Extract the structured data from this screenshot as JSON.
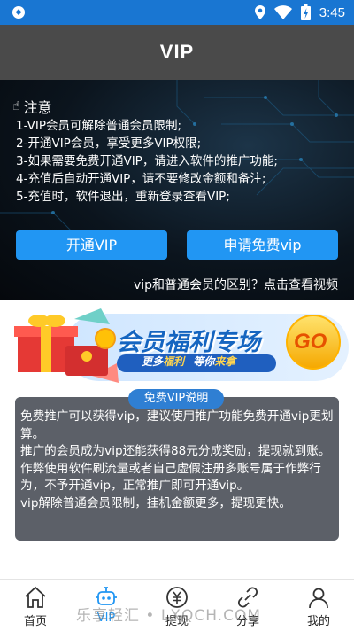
{
  "status_bar": {
    "time": "3:45"
  },
  "header": {
    "title": "VIP"
  },
  "notice": {
    "title": "注意",
    "items": [
      "1-VIP会员可解除普通会员限制;",
      "2-开通VIP会员，享受更多VIP权限;",
      "3-如果需要免费开通VIP，请进入软件的推广功能;",
      "4-充值后自动开通VIP，请不要修改金额和备注;",
      "5-充值时，软件退出，重新登录查看VIP;"
    ]
  },
  "buttons": {
    "open_vip": "开通VIP",
    "apply_free_vip": "申请免费vip"
  },
  "video_link": "vip和普通会员的区别？点击查看视频",
  "banner": {
    "title": "会员福利专场",
    "slogan_prefix": "更多",
    "slogan_welfare": "福利",
    "slogan_mid": "等你",
    "slogan_end": "来拿",
    "go": "GO"
  },
  "free_vip_info": {
    "label": "免费VIP说明",
    "paragraphs": [
      "免费推广可以获得vip，建议使用推广功能免费开通vip更划算。",
      "推广的会员成为vip还能获得88元分成奖励，提现就到账。",
      "作弊使用软件刷流量或者自己虚假注册多账号属于作弊行为，不予开通vip，正常推广即可开通vip。",
      "vip解除普通会员限制，挂机金额更多，提现更快。"
    ]
  },
  "bottom_nav": [
    {
      "label": "首页",
      "icon": "home-icon"
    },
    {
      "label": "VIP",
      "icon": "robot-icon",
      "active": true
    },
    {
      "label": "提现",
      "icon": "withdraw-icon"
    },
    {
      "label": "分享",
      "icon": "share-icon"
    },
    {
      "label": "我的",
      "icon": "profile-icon"
    }
  ],
  "watermark": "乐享轻汇 • LXQCH.COM",
  "colors": {
    "status_bar": "#1976d2",
    "title_bar": "#4a4a4a",
    "button": "#2196f3",
    "info_box": "#5c6068",
    "active_nav": "#2196f3"
  }
}
